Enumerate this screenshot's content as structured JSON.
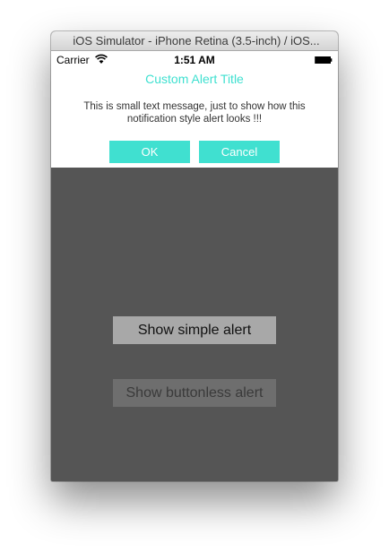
{
  "window": {
    "title": "iOS Simulator - iPhone Retina (3.5-inch) / iOS..."
  },
  "status_bar": {
    "carrier": "Carrier",
    "time": "1:51 AM",
    "wifi_icon": "wifi-icon",
    "battery_icon": "battery-icon"
  },
  "alert": {
    "title": "Custom Alert Title",
    "message": "This is small text message, just to show how this notification style alert looks !!!",
    "ok_label": "OK",
    "cancel_label": "Cancel",
    "accent_color": "#40e0d0"
  },
  "main": {
    "simple_alert_label": "Show simple alert",
    "buttonless_alert_label": "Show buttonless alert",
    "background_color": "#555555"
  }
}
